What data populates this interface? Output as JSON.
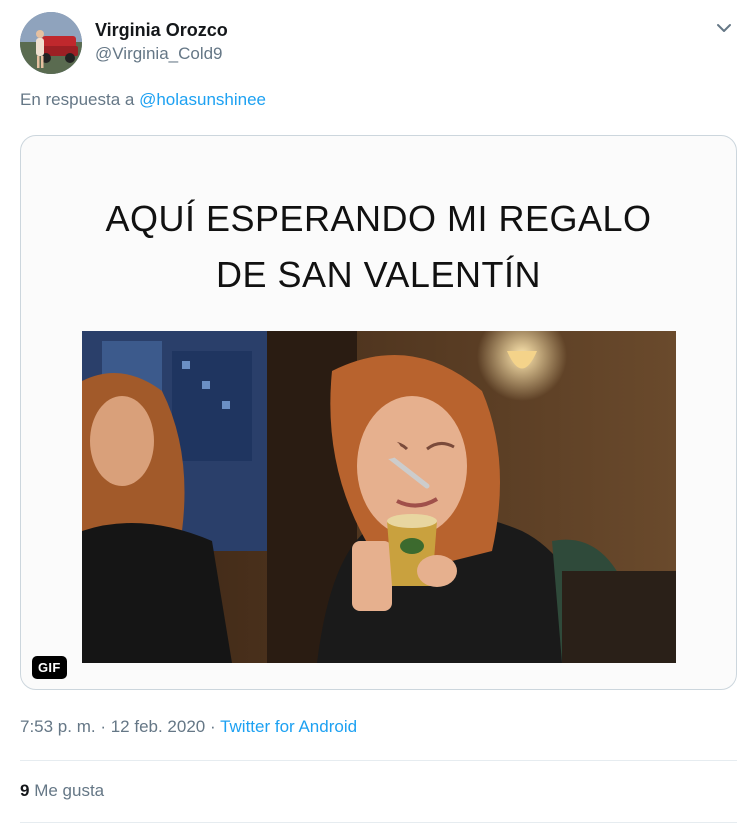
{
  "user": {
    "name": "Virginia Orozco",
    "handle": "@Virginia_Cold9",
    "avatar_icon": "profile-photo"
  },
  "reply": {
    "prefix": "En respuesta a",
    "mention": "@holasunshinee"
  },
  "media": {
    "caption_line1": "AQUÍ ESPERANDO MI REGALO",
    "caption_line2": "DE SAN VALENTÍN",
    "badge": "GIF",
    "image_icon": "woman-eating-ice-cream-gif"
  },
  "meta": {
    "time": "7:53 p. m.",
    "separator1": " · ",
    "date": "12 feb. 2020",
    "separator2": " · ",
    "source": "Twitter for Android"
  },
  "likes": {
    "count": "9",
    "label": "Me gusta"
  },
  "colors": {
    "link": "#1da1f2",
    "secondary_text": "#657786",
    "border": "#ccd6dd"
  },
  "icons": {
    "more": "chevron-down-icon"
  }
}
